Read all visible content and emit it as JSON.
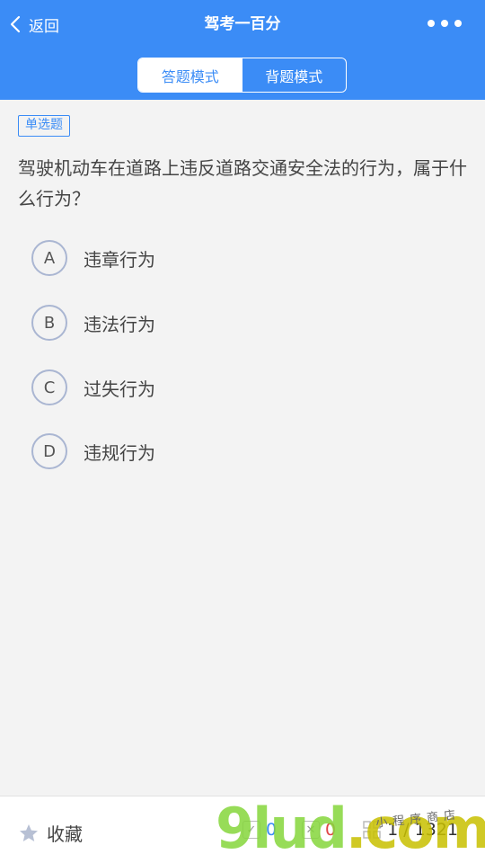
{
  "header": {
    "back_label": "返回",
    "title": "驾考一百分",
    "modes": [
      "答题模式",
      "背题模式"
    ],
    "active_mode": 0
  },
  "question": {
    "type_tag": "单选题",
    "text": "驾驶机动车在道路上违反道路交通安全法的行为，属于什么行为？",
    "options": [
      {
        "letter": "A",
        "text": "违章行为"
      },
      {
        "letter": "B",
        "text": "违法行为"
      },
      {
        "letter": "C",
        "text": "过失行为"
      },
      {
        "letter": "D",
        "text": "违规行为"
      }
    ]
  },
  "bottom": {
    "favorite_label": "收藏",
    "right_count": "0",
    "wrong_count": "0",
    "progress": "1 / 1321"
  },
  "watermark": {
    "logo": "9lud",
    "logo_suffix": ".com",
    "subtitle": "小程序商店"
  },
  "colors": {
    "primary": "#3b8cf6",
    "wrong": "#e04545",
    "background": "#f3f3f3"
  }
}
